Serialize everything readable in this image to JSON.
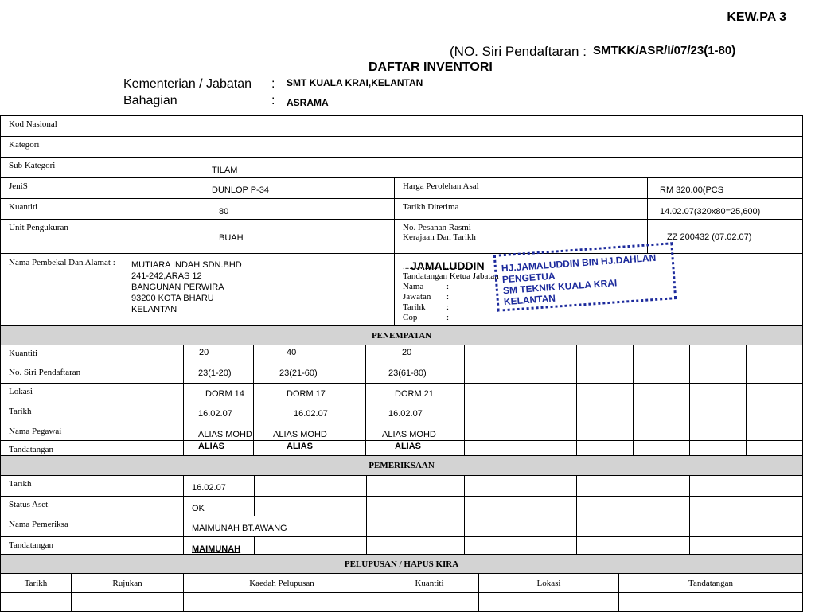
{
  "header": {
    "form_code": "KEW.PA 3",
    "siri_label": "(NO. Siri Pendaftaran :",
    "siri_value": "SMTKK/ASR/I/07/23(1-80)",
    "title": "DAFTAR INVENTORI",
    "ministry_label": "Kementerian / Jabatan",
    "ministry_value": "SMT KUALA KRAI,KELANTAN",
    "division_label": "Bahagian",
    "division_value": "ASRAMA",
    "colon": ":"
  },
  "details": {
    "kod_nasional": {
      "label": "Kod Nasional",
      "value": ""
    },
    "kategori": {
      "label": "Kategori",
      "value": ""
    },
    "sub_kategori": {
      "label": "Sub Kategori",
      "value": "TILAM"
    },
    "jenis": {
      "label": "JeniS",
      "value": "DUNLOP P-34"
    },
    "harga": {
      "label": "Harga Perolehan Asal",
      "value": "RM 320.00(PCS"
    },
    "kuantiti": {
      "label": "Kuantiti",
      "value": "80"
    },
    "tarikh_diterima": {
      "label": "Tarikh Diterima",
      "value": "14.02.07(320x80=25,600)"
    },
    "unit": {
      "label": "Unit Pengukuran",
      "value": "BUAH"
    },
    "pesanan_line1": "No. Pesanan Rasmi",
    "pesanan_line2": "Kerajaan Dan Tarikh",
    "pesanan_value": "ZZ 200432 (07.02.07)",
    "pembekal_label": "Nama Pembekal Dan Alamat :",
    "pembekal_lines": [
      "MUTIARA INDAH SDN.BHD",
      "241-242,ARAS 12",
      "BANGUNAN PERWIRA",
      "93200 KOTA BHARU",
      "KELANTAN"
    ],
    "ketua_dots": "...............................",
    "ketua_sig": "JAMALUDDIN",
    "ketua_label": "Tandatangan Ketua Jabatan",
    "nama_label": "Nama",
    "jawatan_label": "Jawatan",
    "tarikh_label": "Tarihk",
    "cop_label": "Cop",
    "colon": ":"
  },
  "stamp": {
    "lines": [
      "HJ.JAMALUDDIN BIN HJ.DAHLAN",
      "PENGETUA",
      "SM TEKNIK KUALA KRAI",
      "KELANTAN"
    ]
  },
  "penempatan": {
    "title": "PENEMPATAN",
    "rows": [
      {
        "label": "Kuantiti",
        "values": [
          "20",
          "40",
          "20"
        ]
      },
      {
        "label": "No. Siri Pendaftaran",
        "values": [
          "23(1-20)",
          "23(21-60)",
          "23(61-80)"
        ]
      },
      {
        "label": "Lokasi",
        "values": [
          "DORM 14",
          "DORM 17",
          "DORM 21"
        ]
      },
      {
        "label": "Tarikh",
        "values": [
          "16.02.07",
          "16.02.07",
          "16.02.07"
        ]
      },
      {
        "label": "Nama Pegawai",
        "values": [
          "ALIAS MOHD",
          "ALIAS MOHD",
          "ALIAS MOHD"
        ]
      },
      {
        "label": "Tandatangan",
        "values": [
          "ALIAS",
          "ALIAS",
          "ALIAS"
        ]
      }
    ]
  },
  "pemeriksaan": {
    "title": "PEMERIKSAAN",
    "rows": [
      {
        "label": "Tarikh",
        "value": "16.02.07"
      },
      {
        "label": "Status Aset",
        "value": "OK"
      },
      {
        "label": "Nama Pemeriksa",
        "value": "MAIMUNAH BT.AWANG"
      },
      {
        "label": "Tandatangan",
        "value": "MAIMUNAH"
      }
    ]
  },
  "pelupusan": {
    "title": "PELUPUSAN / HAPUS KIRA",
    "headers": [
      "Tarikh",
      "Rujukan",
      "Kaedah Pelupusan",
      "Kuantiti",
      "Lokasi",
      "Tandatangan"
    ]
  },
  "colors": {
    "stamp": "#1c2a9c",
    "section_bg": "#d3d3d3"
  }
}
